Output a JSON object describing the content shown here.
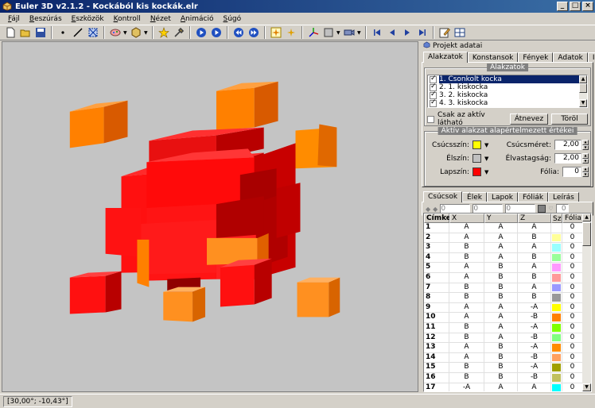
{
  "window": {
    "title": "Euler 3D v2.1.2 - Kockából kis kockák.elr"
  },
  "menu": [
    "Fájl",
    "Beszúrás",
    "Eszközök",
    "Kontroll",
    "Nézet",
    "Animáció",
    "Súgó"
  ],
  "status": {
    "coords": "[30,00°; -10,43°]"
  },
  "project": {
    "header": "Projekt adatai",
    "tabs": [
      "Alakzatok",
      "Konstansok",
      "Fények",
      "Adatok",
      "Infó"
    ],
    "shapes_group_title": "Alakzatok",
    "shapes": [
      "1. Csonkolt kocka",
      "2. 1. kiskocka",
      "3. 2. kiskocka",
      "4. 3. kiskocka"
    ],
    "only_active_label": "Csak az aktív látható",
    "rename_label": "Átnevez",
    "delete_label": "Töröl",
    "defaults_group_title": "Aktív alakzat alapértelmezett értékei",
    "vertex_color_label": "Csúcsszín:",
    "edge_color_label": "Élszín:",
    "face_color_label": "Lapszín:",
    "vertex_size_label": "Csúcsméret:",
    "vertex_size_value": "2,00",
    "thickness_label": "Élvastagság:",
    "thickness_value": "2,00",
    "foil_label": "Fólia:",
    "foil_value": "0",
    "colors": {
      "vertex": "#ffff00",
      "edge": "#c0c0c0",
      "face": "#ff0000"
    }
  },
  "vertices": {
    "tabs": [
      "Csúcsok",
      "Élek",
      "Lapok",
      "Fóliák",
      "Leírás"
    ],
    "filter_values": [
      "0",
      "0",
      "0",
      "0"
    ],
    "columns": [
      "Címke",
      "X",
      "Y",
      "Z",
      "Sz",
      "Fólia"
    ],
    "rows": [
      {
        "id": "1",
        "x": "A",
        "y": "A",
        "z": "A",
        "color": "#ffffff",
        "f": "0"
      },
      {
        "id": "2",
        "x": "A",
        "y": "A",
        "z": "B",
        "color": "#ffff99",
        "f": "0"
      },
      {
        "id": "3",
        "x": "B",
        "y": "A",
        "z": "A",
        "color": "#99ffff",
        "f": "0"
      },
      {
        "id": "4",
        "x": "B",
        "y": "A",
        "z": "B",
        "color": "#99ff99",
        "f": "0"
      },
      {
        "id": "5",
        "x": "A",
        "y": "B",
        "z": "A",
        "color": "#ff99ff",
        "f": "0"
      },
      {
        "id": "6",
        "x": "A",
        "y": "B",
        "z": "B",
        "color": "#ff9999",
        "f": "0"
      },
      {
        "id": "7",
        "x": "B",
        "y": "B",
        "z": "A",
        "color": "#9999ff",
        "f": "0"
      },
      {
        "id": "8",
        "x": "B",
        "y": "B",
        "z": "B",
        "color": "#999999",
        "f": "0"
      },
      {
        "id": "9",
        "x": "A",
        "y": "A",
        "z": "-A",
        "color": "#ffff00",
        "f": "0"
      },
      {
        "id": "10",
        "x": "A",
        "y": "A",
        "z": "-B",
        "color": "#ff8000",
        "f": "0"
      },
      {
        "id": "11",
        "x": "B",
        "y": "A",
        "z": "-A",
        "color": "#80ff00",
        "f": "0"
      },
      {
        "id": "12",
        "x": "B",
        "y": "A",
        "z": "-B",
        "color": "#80ff80",
        "f": "0"
      },
      {
        "id": "13",
        "x": "A",
        "y": "B",
        "z": "-A",
        "color": "#ff8c00",
        "f": "0"
      },
      {
        "id": "14",
        "x": "A",
        "y": "B",
        "z": "-B",
        "color": "#ffa060",
        "f": "0"
      },
      {
        "id": "15",
        "x": "B",
        "y": "B",
        "z": "-A",
        "color": "#a0a000",
        "f": "0"
      },
      {
        "id": "16",
        "x": "B",
        "y": "B",
        "z": "-B",
        "color": "#c0c060",
        "f": "0"
      },
      {
        "id": "17",
        "x": "-A",
        "y": "A",
        "z": "A",
        "color": "#00ffff",
        "f": "0"
      }
    ]
  }
}
